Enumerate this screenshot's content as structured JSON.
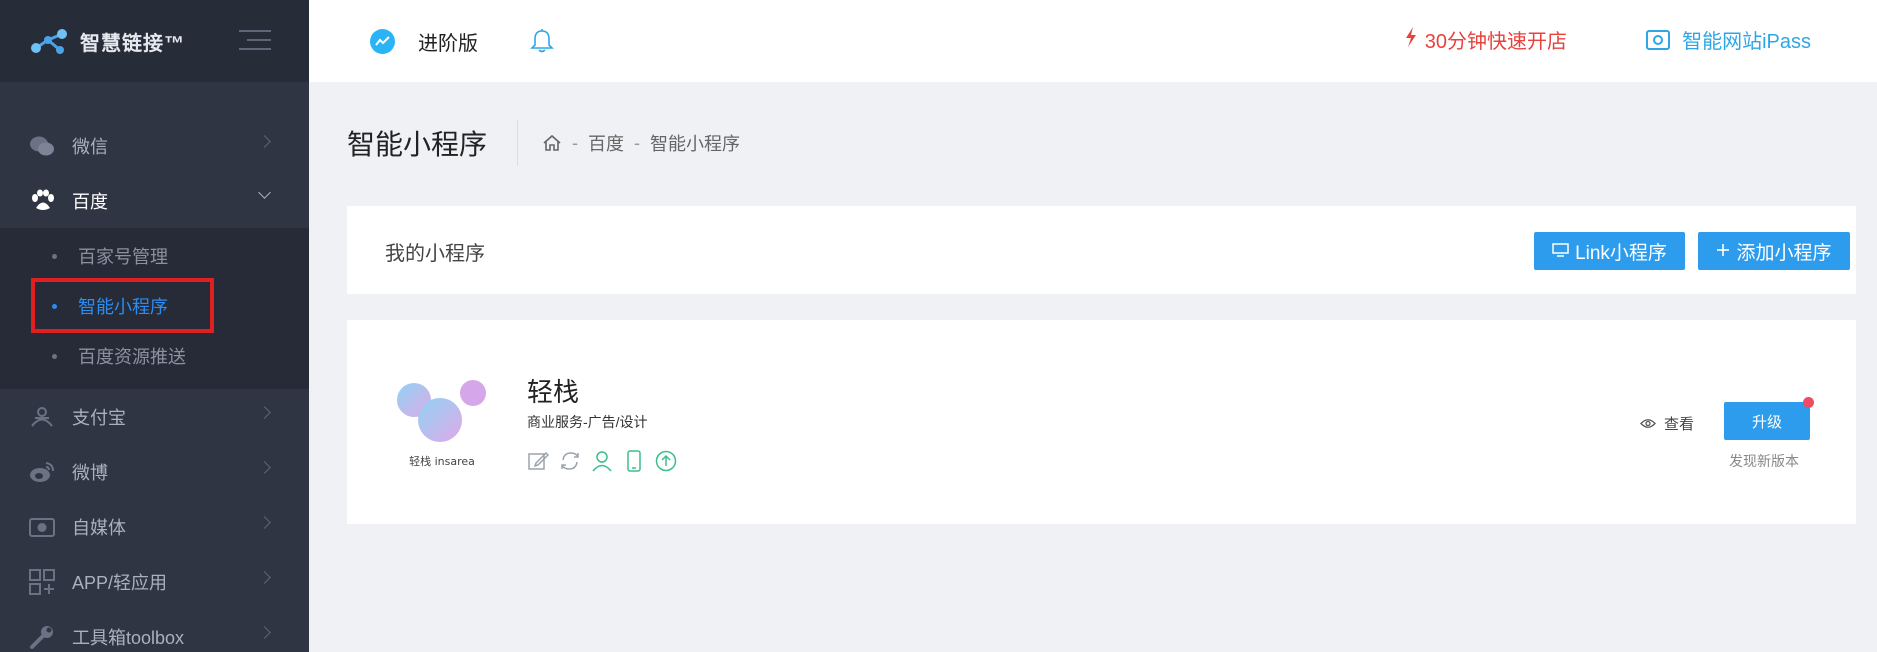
{
  "app": {
    "brand": "智慧链接™"
  },
  "topbar": {
    "version_label": "进阶版",
    "quick_open": "30分钟快速开店",
    "ipass": "智能网站iPass"
  },
  "sidebar": {
    "items": [
      {
        "label": "微信",
        "icon": "wechat-icon"
      },
      {
        "label": "百度",
        "icon": "paw-icon",
        "open": true,
        "children": [
          "百家号管理",
          "智能小程序",
          "百度资源推送"
        ],
        "active_child": "智能小程序"
      },
      {
        "label": "支付宝",
        "icon": "alipay-icon"
      },
      {
        "label": "微博",
        "icon": "weibo-icon"
      },
      {
        "label": "自媒体",
        "icon": "media-icon"
      },
      {
        "label": "APP/轻应用",
        "icon": "apps-icon"
      },
      {
        "label": "工具箱toolbox",
        "icon": "wrench-icon"
      }
    ]
  },
  "page": {
    "title": "智能小程序",
    "breadcrumb": [
      "百度",
      "智能小程序"
    ]
  },
  "mini_programs": {
    "header_label": "我的小程序",
    "link_button": "Link小程序",
    "add_button": "添加小程序"
  },
  "program": {
    "name": "轻栈",
    "category": "商业服务-广告/设计",
    "logo_text": "轻栈 insarea",
    "view_label": "查看",
    "upgrade_label": "升级",
    "new_version": "发现新版本"
  },
  "colors": {
    "sidebar_bg": "#2f3542",
    "accent": "#2d9ced",
    "active": "#2d8cf0",
    "alert": "#e8423d"
  }
}
